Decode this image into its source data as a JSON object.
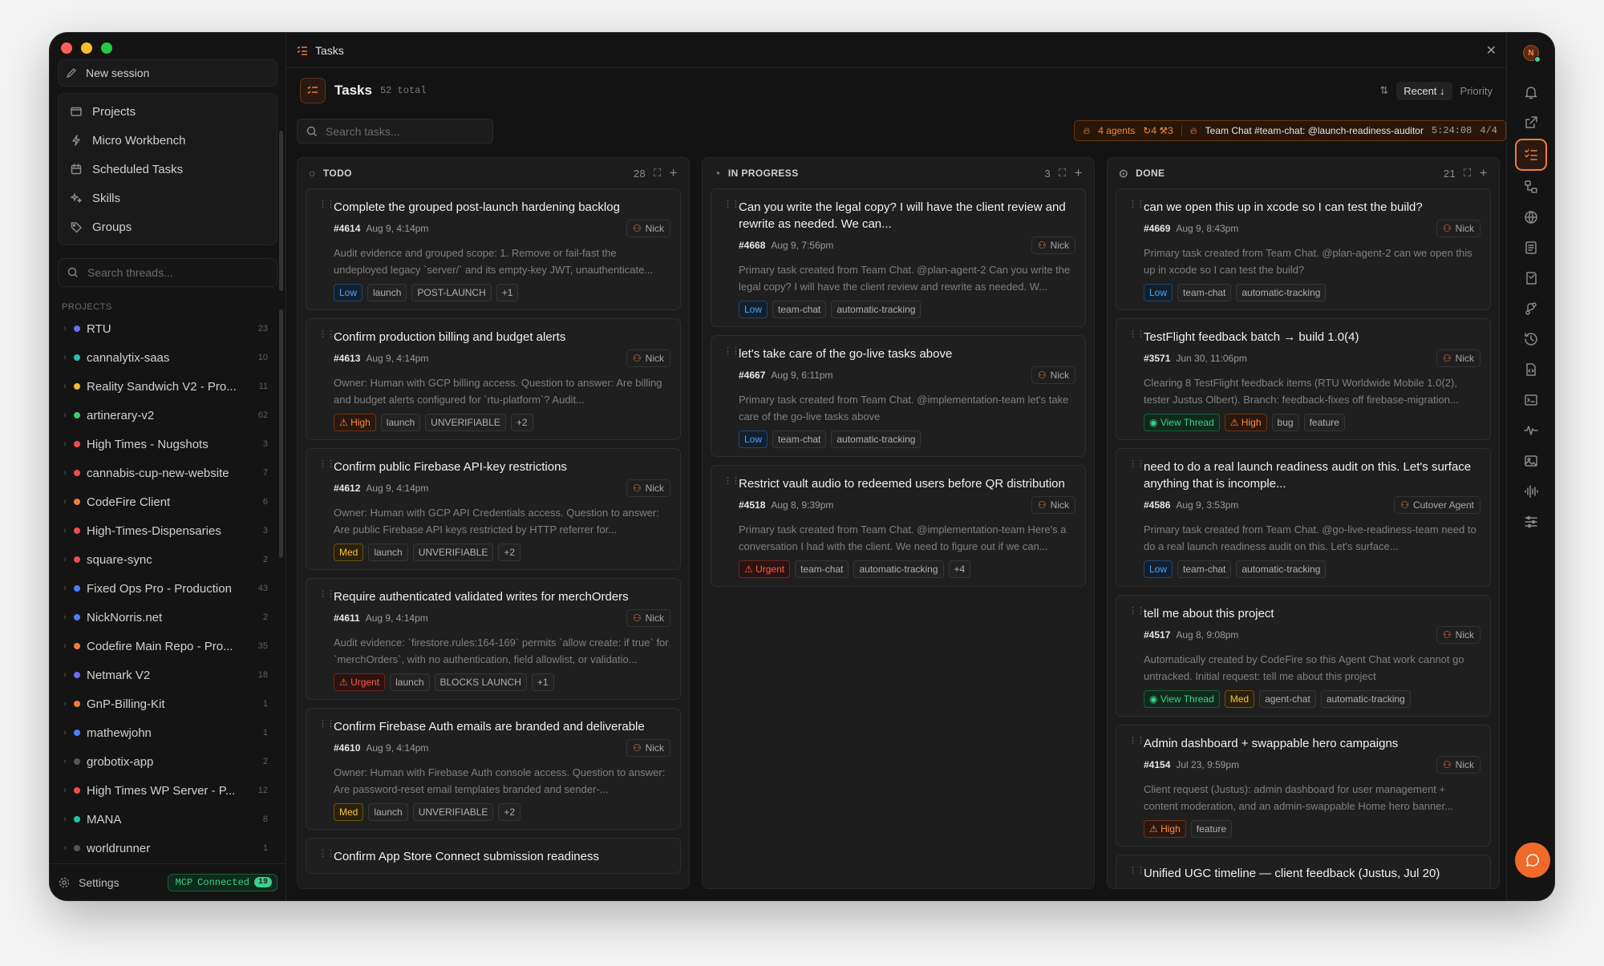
{
  "window": {
    "title": "Tasks"
  },
  "sidebar": {
    "new_session": "New session",
    "nav": [
      {
        "label": "Projects",
        "icon": "folder-icon"
      },
      {
        "label": "Micro Workbench",
        "icon": "bolt-icon"
      },
      {
        "label": "Scheduled Tasks",
        "icon": "calendar-icon"
      },
      {
        "label": "Skills",
        "icon": "sparkles-icon"
      },
      {
        "label": "Groups",
        "icon": "tag-icon"
      }
    ],
    "search_placeholder": "Search threads...",
    "projects_label": "PROJECTS",
    "projects": [
      {
        "name": "RTU",
        "count": "23",
        "color": "#6b6bff"
      },
      {
        "name": "cannalytix-saas",
        "count": "10",
        "color": "#22c3b0"
      },
      {
        "name": "Reality Sandwich V2 - Pro...",
        "count": "11",
        "color": "#f5b82e"
      },
      {
        "name": "artinerary-v2",
        "count": "62",
        "color": "#3ecf6e"
      },
      {
        "name": "High Times - Nugshots",
        "count": "3",
        "color": "#ef4e4e"
      },
      {
        "name": "cannabis-cup-new-website",
        "count": "7",
        "color": "#ef4e4e"
      },
      {
        "name": "CodeFire Client",
        "count": "6",
        "color": "#f07c3a"
      },
      {
        "name": "High-Times-Dispensaries",
        "count": "3",
        "color": "#ef4e4e"
      },
      {
        "name": "square-sync",
        "count": "2",
        "color": "#ef4e4e"
      },
      {
        "name": "Fixed Ops Pro - Production",
        "count": "43",
        "color": "#4f7cff"
      },
      {
        "name": "NickNorris.net",
        "count": "2",
        "color": "#4f7cff"
      },
      {
        "name": "Codefire Main Repo - Pro...",
        "count": "35",
        "color": "#f07c3a"
      },
      {
        "name": "Netmark V2",
        "count": "18",
        "color": "#6b6bff"
      },
      {
        "name": "GnP-Billing-Kit",
        "count": "1",
        "color": "#f07c3a"
      },
      {
        "name": "mathewjohn",
        "count": "1",
        "color": "#4f7cff"
      },
      {
        "name": "grobotix-app",
        "count": "2",
        "color": "#555555"
      },
      {
        "name": "High Times WP Server - P...",
        "count": "12",
        "color": "#ef4e4e"
      },
      {
        "name": "MANA",
        "count": "8",
        "color": "#22c3b0"
      },
      {
        "name": "worldrunner",
        "count": "1",
        "color": "#555555"
      }
    ],
    "settings": "Settings",
    "mcp": {
      "label": "MCP",
      "status": "Connected",
      "count": "19"
    }
  },
  "header": {
    "title": "Tasks",
    "total": "52 total",
    "sort_active": "Recent",
    "sort_other": "Priority",
    "search_placeholder": "Search tasks...",
    "agents": {
      "count": "4 agents",
      "c1": "4",
      "c2": "3",
      "chat": "Team Chat #team-chat: @launch-readiness-auditor",
      "time": "5:24:08",
      "progress": "4/4"
    }
  },
  "columns": [
    {
      "name": "TODO",
      "count": "28",
      "cards": [
        {
          "title": "Complete the grouped post-launch hardening backlog",
          "num": "#4614",
          "date": "Aug 9, 4:14pm",
          "assignee": "Nick",
          "desc": "Audit evidence and grouped scope: 1. Remove or fail-fast the undeployed legacy `server/` and its empty-key JWT, unauthenticate...",
          "tags": [
            {
              "t": "Low",
              "k": "low"
            },
            {
              "t": "launch"
            },
            {
              "t": "POST-LAUNCH"
            },
            {
              "t": "+1"
            }
          ]
        },
        {
          "title": "Confirm production billing and budget alerts",
          "num": "#4613",
          "date": "Aug 9, 4:14pm",
          "assignee": "Nick",
          "desc": "Owner: Human with GCP billing access. Question to answer: Are billing and budget alerts configured for `rtu-platform`? Audit...",
          "tags": [
            {
              "t": "High",
              "k": "high"
            },
            {
              "t": "launch"
            },
            {
              "t": "UNVERIFIABLE"
            },
            {
              "t": "+2"
            }
          ]
        },
        {
          "title": "Confirm public Firebase API-key restrictions",
          "num": "#4612",
          "date": "Aug 9, 4:14pm",
          "assignee": "Nick",
          "desc": "Owner: Human with GCP API Credentials access. Question to answer: Are public Firebase API keys restricted by HTTP referrer for...",
          "tags": [
            {
              "t": "Med",
              "k": "med"
            },
            {
              "t": "launch"
            },
            {
              "t": "UNVERIFIABLE"
            },
            {
              "t": "+2"
            }
          ]
        },
        {
          "title": "Require authenticated validated writes for merchOrders",
          "num": "#4611",
          "date": "Aug 9, 4:14pm",
          "assignee": "Nick",
          "desc": "Audit evidence: `firestore.rules:164-169` permits `allow create: if true` for `merchOrders`, with no authentication, field allowlist, or validatio...",
          "tags": [
            {
              "t": "Urgent",
              "k": "urgent"
            },
            {
              "t": "launch"
            },
            {
              "t": "BLOCKS LAUNCH"
            },
            {
              "t": "+1"
            }
          ]
        },
        {
          "title": "Confirm Firebase Auth emails are branded and deliverable",
          "num": "#4610",
          "date": "Aug 9, 4:14pm",
          "assignee": "Nick",
          "desc": "Owner: Human with Firebase Auth console access. Question to answer: Are password-reset email templates branded and sender-...",
          "tags": [
            {
              "t": "Med",
              "k": "med"
            },
            {
              "t": "launch"
            },
            {
              "t": "UNVERIFIABLE"
            },
            {
              "t": "+2"
            }
          ]
        },
        {
          "title": "Confirm App Store Connect submission readiness",
          "num": "",
          "date": "",
          "assignee": "",
          "desc": "",
          "tags": []
        }
      ]
    },
    {
      "name": "IN PROGRESS",
      "count": "3",
      "cards": [
        {
          "title": "Can you write the legal copy? I will have the client review and rewrite as needed. We can...",
          "num": "#4668",
          "date": "Aug 9, 7:56pm",
          "assignee": "Nick",
          "desc": "Primary task created from Team Chat. @plan-agent-2 Can you write the legal copy? I will have the client review and rewrite as needed. W...",
          "tags": [
            {
              "t": "Low",
              "k": "low"
            },
            {
              "t": "team-chat"
            },
            {
              "t": "automatic-tracking"
            }
          ]
        },
        {
          "title": "let's take care of the go-live tasks above",
          "num": "#4667",
          "date": "Aug 9, 6:11pm",
          "assignee": "Nick",
          "desc": "Primary task created from Team Chat. @implementation-team let's take care of the go-live tasks above",
          "tags": [
            {
              "t": "Low",
              "k": "low"
            },
            {
              "t": "team-chat"
            },
            {
              "t": "automatic-tracking"
            }
          ]
        },
        {
          "title": "Restrict vault audio to redeemed users before QR distribution",
          "num": "#4518",
          "date": "Aug 8, 9:39pm",
          "assignee": "Nick",
          "desc": "Primary task created from Team Chat. @implementation-team Here's a conversation I had with the client. We need to figure out if we can...",
          "tags": [
            {
              "t": "Urgent",
              "k": "urgent"
            },
            {
              "t": "team-chat"
            },
            {
              "t": "automatic-tracking"
            },
            {
              "t": "+4"
            }
          ]
        }
      ]
    },
    {
      "name": "DONE",
      "count": "21",
      "cards": [
        {
          "title": "can we open this up in xcode so I can test the build?",
          "num": "#4669",
          "date": "Aug 9, 8:43pm",
          "assignee": "Nick",
          "desc": "Primary task created from Team Chat. @plan-agent-2 can we open this up in xcode so I can test the build?",
          "tags": [
            {
              "t": "Low",
              "k": "low"
            },
            {
              "t": "team-chat"
            },
            {
              "t": "automatic-tracking"
            }
          ]
        },
        {
          "title": "TestFlight feedback batch → build 1.0(4)",
          "num": "#3571",
          "date": "Jun 30, 11:06pm",
          "assignee": "Nick",
          "desc": "Clearing 8 TestFlight feedback items (RTU Worldwide Mobile 1.0(2), tester Justus Olbert). Branch: feedback-fixes off firebase-migration...",
          "tags": [
            {
              "t": "View Thread",
              "k": "view"
            },
            {
              "t": "High",
              "k": "high"
            },
            {
              "t": "bug"
            },
            {
              "t": "feature"
            }
          ]
        },
        {
          "title": "need to do a real launch readiness audit on this. Let's surface anything that is incomple...",
          "num": "#4586",
          "date": "Aug 9, 3:53pm",
          "assignee": "Cutover Agent",
          "desc": "Primary task created from Team Chat. @go-live-readiness-team need to do a real launch readiness audit on this. Let's surface...",
          "tags": [
            {
              "t": "Low",
              "k": "low"
            },
            {
              "t": "team-chat"
            },
            {
              "t": "automatic-tracking"
            }
          ]
        },
        {
          "title": "tell me about this project",
          "num": "#4517",
          "date": "Aug 8, 9:08pm",
          "assignee": "Nick",
          "desc": "Automatically created by CodeFire so this Agent Chat work cannot go untracked. Initial request: tell me about this project",
          "tags": [
            {
              "t": "View Thread",
              "k": "view"
            },
            {
              "t": "Med",
              "k": "med"
            },
            {
              "t": "agent-chat"
            },
            {
              "t": "automatic-tracking"
            }
          ]
        },
        {
          "title": "Admin dashboard + swappable hero campaigns",
          "num": "#4154",
          "date": "Jul 23, 9:59pm",
          "assignee": "Nick",
          "desc": "Client request (Justus): admin dashboard for user management + content moderation, and an admin-swappable Home hero banner...",
          "tags": [
            {
              "t": "High",
              "k": "high"
            },
            {
              "t": "feature"
            }
          ]
        },
        {
          "title": "Unified UGC timeline — client feedback (Justus, Jul 20)",
          "num": "",
          "date": "",
          "assignee": "",
          "desc": "",
          "tags": []
        }
      ]
    }
  ],
  "rail": {
    "avatar": "N",
    "icons": [
      "bell-icon",
      "external-link-icon",
      "tasks-icon",
      "workflow-icon",
      "globe-icon",
      "document-icon",
      "notebook-icon",
      "branch-icon",
      "history-icon",
      "file-code-icon",
      "terminal-icon",
      "activity-icon",
      "image-icon",
      "audio-icon",
      "sliders-icon",
      "chat-icon"
    ]
  },
  "colors": {
    "accent": "#f07c3a",
    "bg": "#141414",
    "success": "#3ecf8e"
  }
}
